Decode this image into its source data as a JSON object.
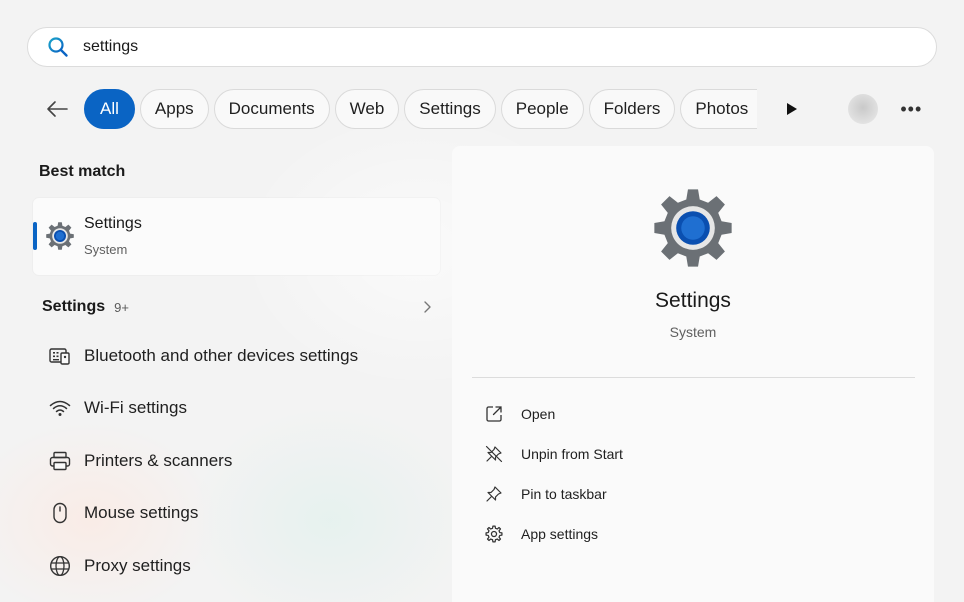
{
  "search": {
    "value": "settings",
    "icon": "search-icon"
  },
  "filters": {
    "chips": [
      "All",
      "Apps",
      "Documents",
      "Web",
      "Settings",
      "People",
      "Folders",
      "Photos"
    ],
    "active": "All",
    "more_icon": "play-arrow-icon",
    "overflow_icon": "more-icon",
    "dots": "•••"
  },
  "best_match": {
    "heading": "Best match",
    "title": "Settings",
    "subtitle": "System"
  },
  "settings_group": {
    "heading": "Settings",
    "count": "9+",
    "items": [
      {
        "label": "Bluetooth and other devices settings",
        "icon": "keyboard-devices-icon"
      },
      {
        "label": "Wi-Fi settings",
        "icon": "wifi-icon"
      },
      {
        "label": "Printers & scanners",
        "icon": "printer-icon"
      },
      {
        "label": "Mouse settings",
        "icon": "mouse-icon"
      },
      {
        "label": "Proxy settings",
        "icon": "globe-icon"
      }
    ]
  },
  "preview": {
    "title": "Settings",
    "subtitle": "System",
    "actions": [
      {
        "label": "Open",
        "icon": "open-external-icon"
      },
      {
        "label": "Unpin from Start",
        "icon": "unpin-icon"
      },
      {
        "label": "Pin to taskbar",
        "icon": "pin-icon"
      },
      {
        "label": "App settings",
        "icon": "gear-icon"
      }
    ]
  },
  "colors": {
    "accent": "#0a64c4",
    "gear_gray": "#6b7075"
  }
}
